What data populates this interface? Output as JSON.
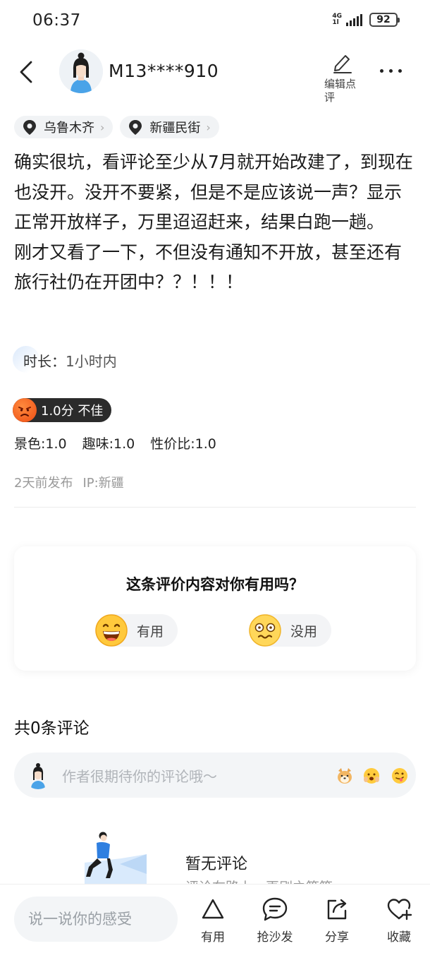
{
  "status_bar": {
    "time": "06:37",
    "network": "4G",
    "network_sub": "1l",
    "battery": "92"
  },
  "nav": {
    "username": "M13****910",
    "edit_label": "编辑点评"
  },
  "tags": [
    {
      "label": "乌鲁木齐"
    },
    {
      "label": "新疆民街"
    }
  ],
  "review": {
    "text": "确实很坑，看评论至少从7月就开始改建了，到现在也没开。没开不要紧，但是不是应该说一声？显示正常开放样子，万里迢迢赶来，结果白跑一趟。\n刚才又看了一下，不但没有通知不开放，甚至还有旅行社仍在开团中？？！！！",
    "duration_label": "时长：",
    "duration_value": "1小时内",
    "score_text": "1.0分 不佳",
    "subscores": [
      {
        "label": "景色:1.0"
      },
      {
        "label": "趣味:1.0"
      },
      {
        "label": "性价比:1.0"
      }
    ],
    "posted": "2天前发布",
    "ip": "IP:新疆"
  },
  "useful_card": {
    "question": "这条评价内容对你有用吗？",
    "yes_label": "有用",
    "no_label": "没用"
  },
  "comments": {
    "count_label": "共0条评论",
    "placeholder": "作者很期待你的评论哦～",
    "empty_title": "暂无评论",
    "empty_sub": "评论在路上，再刷之等等"
  },
  "bottom_bar": {
    "input_placeholder": "说一说你的感受",
    "items": [
      {
        "label": "有用",
        "icon": "triangle-icon"
      },
      {
        "label": "抢沙发",
        "icon": "comment-icon"
      },
      {
        "label": "分享",
        "icon": "share-icon"
      },
      {
        "label": "收藏",
        "icon": "heart-plus-icon"
      }
    ]
  },
  "colors": {
    "accent_dark": "#2b2b2b",
    "score_face": "#ee4d14"
  }
}
